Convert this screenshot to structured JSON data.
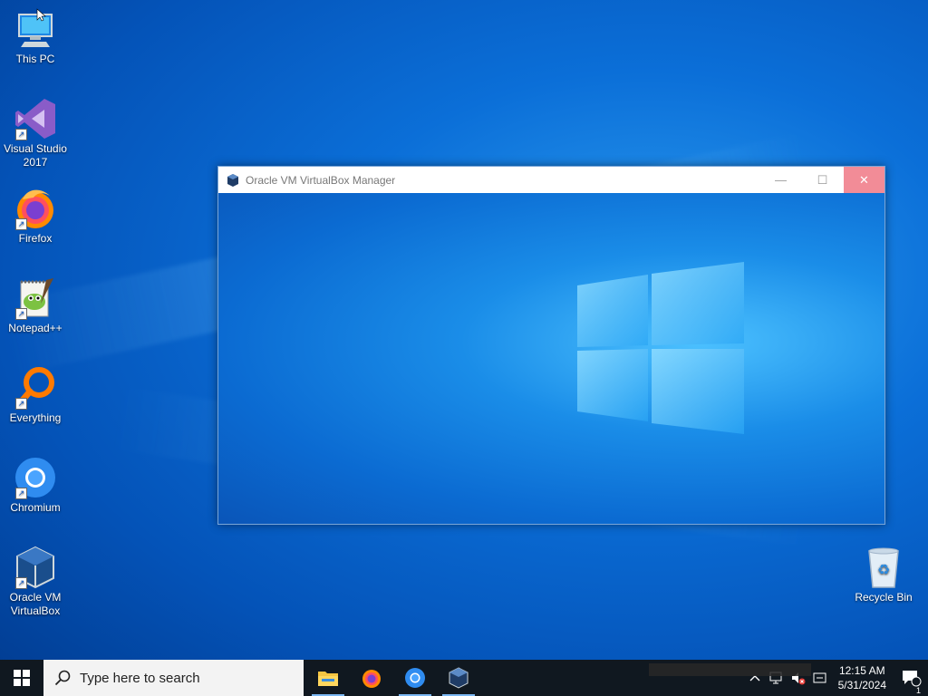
{
  "desktop": {
    "icons": [
      {
        "label": "This PC"
      },
      {
        "label": "Visual Studio 2017"
      },
      {
        "label": "Firefox"
      },
      {
        "label": "Notepad++"
      },
      {
        "label": "Everything"
      },
      {
        "label": "Chromium"
      },
      {
        "label": "Oracle VM VirtualBox"
      },
      {
        "label": "Recycle Bin"
      }
    ]
  },
  "window": {
    "title": "Oracle VM VirtualBox Manager",
    "min_glyph": "—",
    "max_glyph": "☐",
    "close_glyph": "✕"
  },
  "taskbar": {
    "search_placeholder": "Type here to search",
    "apps": [
      "File Explorer",
      "Firefox",
      "Chromium",
      "Oracle VM VirtualBox"
    ],
    "clock_time": "12:15 AM",
    "clock_date": "5/31/2024",
    "notification_count": "1"
  },
  "colors": {
    "desktop_blue": "#0b6fd8",
    "close_button": "#f28c97",
    "taskbar": "#101820"
  }
}
